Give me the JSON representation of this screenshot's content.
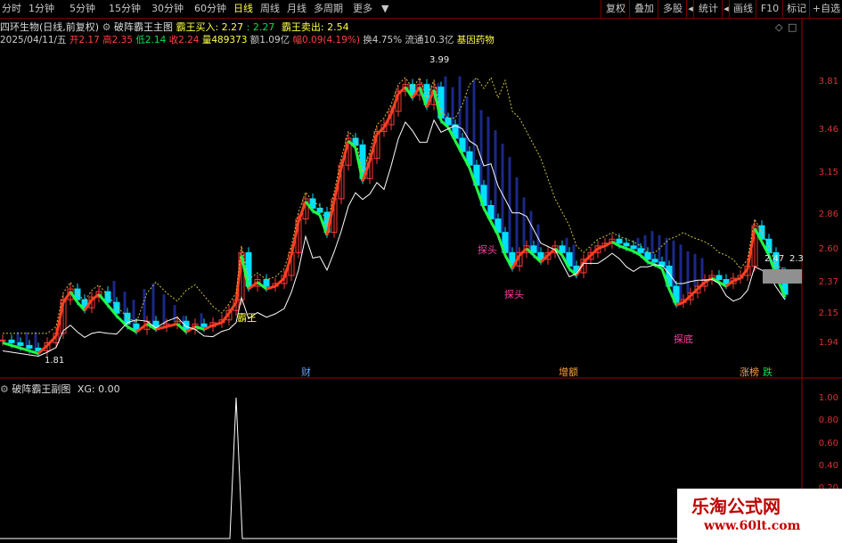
{
  "toolbar": {
    "periods": [
      "分时",
      "1分钟",
      "5分钟",
      "15分钟",
      "30分钟",
      "60分钟",
      "日线",
      "周线",
      "月线",
      "多周期",
      "更多"
    ],
    "active_period": "日线",
    "right_buttons": [
      "复权",
      "叠加",
      "多股",
      "统计",
      "画线",
      "F10",
      "标记",
      "+自选"
    ],
    "back_icon": "back-arrow-icon"
  },
  "main_panel": {
    "stock_title": "四环生物(日线,前复权)",
    "indicator_name": "破阵霸王主图",
    "buy_label": "霸王买入: 2.27",
    "buy_value2": ": 2.27",
    "sell_label": "霸王卖出: 2.54",
    "date": "2025/04/11/五",
    "open": "开2.17",
    "high": "高2.35",
    "low": "低2.14",
    "close": "收2.24",
    "volume": "量489373",
    "amount": "额1.09亿",
    "change": "幅0.09(4.19%)",
    "turnover": "换4.75%",
    "float": "流通10.3亿",
    "sector": "基因药物",
    "y_ticks": [
      "3.81",
      "3.46",
      "3.15",
      "2.86",
      "2.60",
      "2.37",
      "2.15",
      "1.94"
    ],
    "price_marks": [
      "3.99",
      "1.81",
      "2.47",
      "2.3"
    ],
    "signals": [
      "霸王",
      "探头",
      "探头",
      "探底"
    ],
    "events": [
      "财",
      "增额",
      "涨榜",
      "跌"
    ]
  },
  "sub_panel": {
    "indicator_name": "破阵霸王副图",
    "xg_label": "XG: 0.00",
    "y_ticks": [
      "1.00",
      "0.80",
      "0.60",
      "0.40",
      "0.20"
    ]
  },
  "colors": {
    "up": "#ff3a3a",
    "down": "#00e0ff",
    "ma_fast": "#ff4020",
    "ma_slow": "#ffffff",
    "cloud": "#2030a0",
    "frame": "#a00000",
    "accent": "#ffff44"
  },
  "watermark": {
    "title": "乐淘公式网",
    "url": "www.60lt.com"
  }
}
